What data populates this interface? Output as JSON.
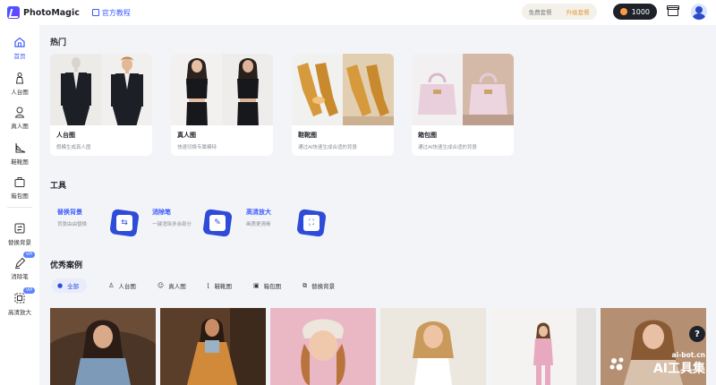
{
  "app": {
    "name": "PhotoMagic",
    "tutorial_label": "官方教程"
  },
  "header": {
    "plan_free": "免费套餐",
    "plan_upgrade": "升级套餐",
    "coins": "1000",
    "icons": [
      "archive-icon",
      "user-avatar"
    ]
  },
  "sidebar": {
    "items": [
      {
        "label": "首页",
        "icon": "home-icon",
        "active": true
      },
      {
        "label": "人台图",
        "icon": "mannequin-icon"
      },
      {
        "label": "真人图",
        "icon": "person-icon"
      },
      {
        "label": "鞋靴图",
        "icon": "shoe-icon"
      },
      {
        "label": "箱包图",
        "icon": "bag-icon"
      },
      {
        "label": "替换背景",
        "icon": "replace-bg-icon"
      },
      {
        "label": "消除笔",
        "icon": "eraser-pen-icon",
        "badge": "VIP"
      },
      {
        "label": "高清放大",
        "icon": "upscale-icon",
        "badge": "VIP"
      }
    ]
  },
  "hot": {
    "title": "热门",
    "cards": [
      {
        "name": "人台图",
        "desc": "假模生成真人图"
      },
      {
        "name": "真人图",
        "desc": "快速切换专属模特"
      },
      {
        "name": "鞋靴图",
        "desc": "通过AI快速生成合适的背景"
      },
      {
        "name": "箱包图",
        "desc": "通过AI快速生成合适的背景"
      }
    ]
  },
  "tools": {
    "title": "工具",
    "items": [
      {
        "name": "替换背景",
        "desc": "背景由由替换",
        "icon": "swap-icon"
      },
      {
        "name": "消除笔",
        "desc": "一键消除多余部分",
        "icon": "pen-icon"
      },
      {
        "name": "高清放大",
        "desc": "画质更清晰",
        "icon": "enlarge-icon"
      }
    ]
  },
  "cases": {
    "title": "优秀案例",
    "filters": [
      {
        "label": "全部",
        "icon": "all-icon",
        "active": true
      },
      {
        "label": "人台图",
        "icon": "mannequin-icon"
      },
      {
        "label": "真人图",
        "icon": "person-icon"
      },
      {
        "label": "鞋靴图",
        "icon": "shoe-icon"
      },
      {
        "label": "箱包图",
        "icon": "bag-icon"
      },
      {
        "label": "替换背景",
        "icon": "replace-bg-icon"
      }
    ]
  },
  "help": "?",
  "watermark": {
    "url": "ai-bot.cn",
    "text": "AI工具集"
  },
  "colors": {
    "accent": "#3b5bff",
    "tool_badge": "#2f4bd9",
    "upgrade": "#e39a3b"
  }
}
